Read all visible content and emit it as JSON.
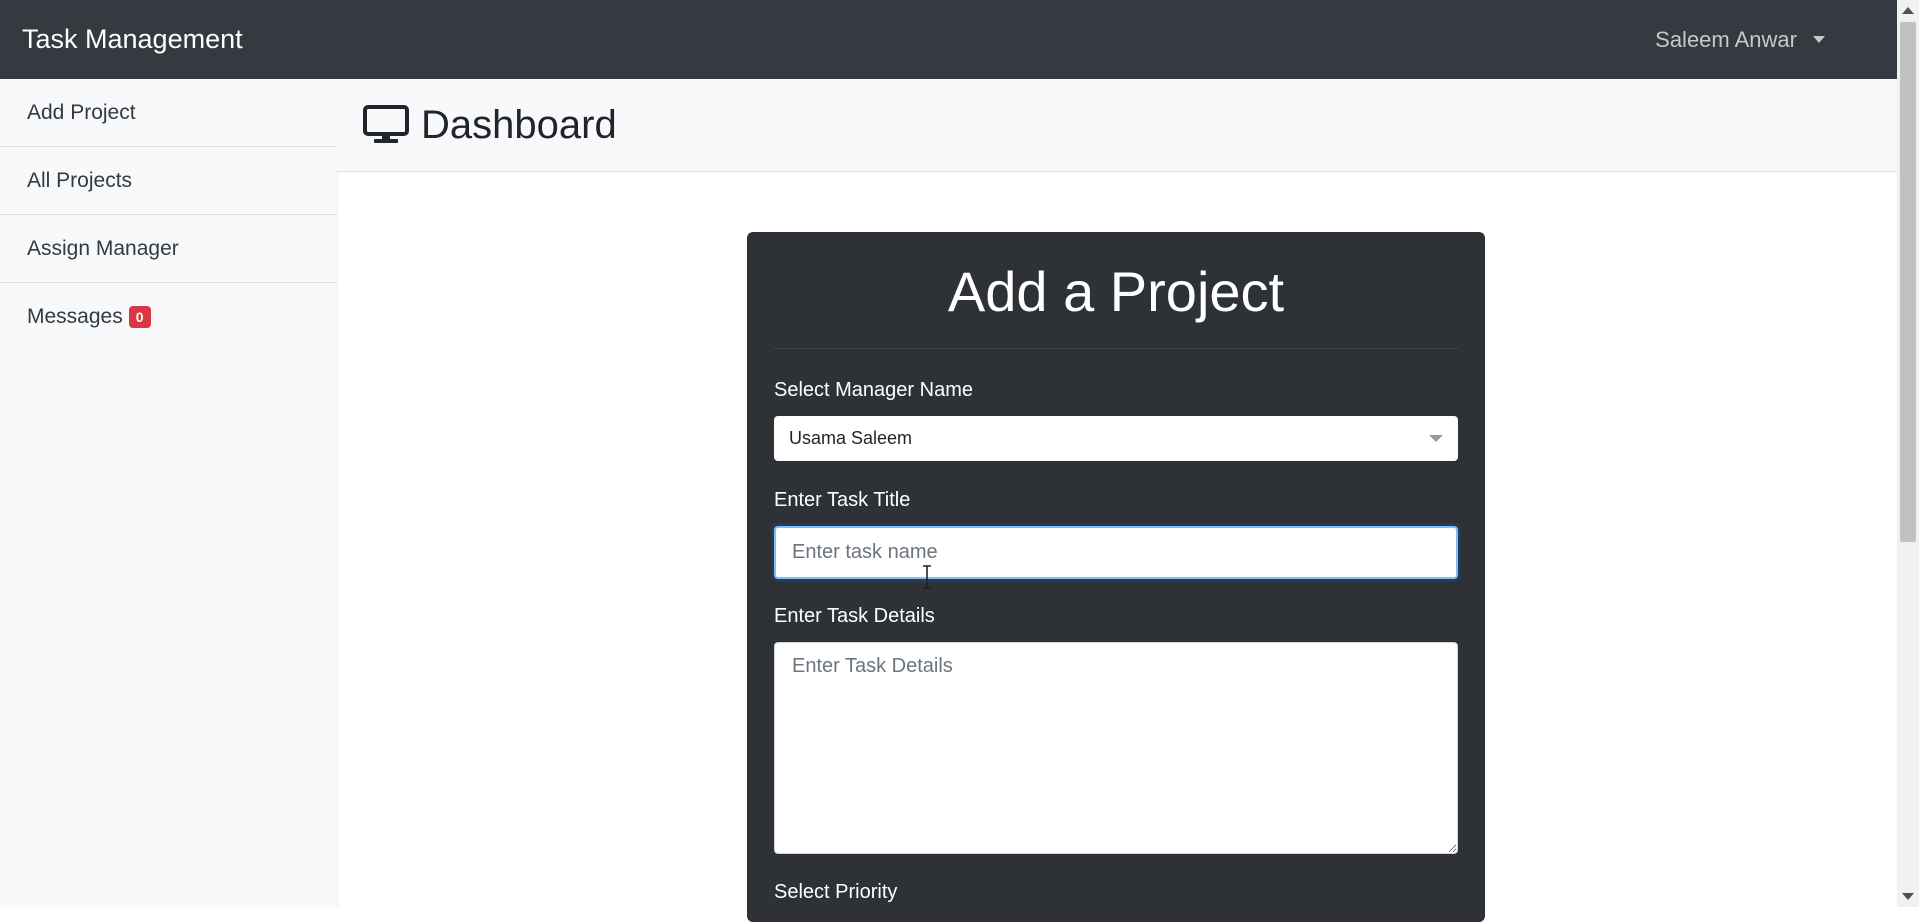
{
  "navbar": {
    "brand": "Task Management",
    "user_name": "Saleem Anwar"
  },
  "sidebar": {
    "items": [
      {
        "label": "Add Project"
      },
      {
        "label": "All Projects"
      },
      {
        "label": "Assign Manager"
      },
      {
        "label": "Messages",
        "badge": "0"
      }
    ]
  },
  "header": {
    "icon": "monitor-icon",
    "title": "Dashboard"
  },
  "form": {
    "title": "Add a Project",
    "manager_label": "Select Manager Name",
    "manager_selected": "Usama Saleem",
    "task_title_label": "Enter Task Title",
    "task_title_placeholder": "Enter task name",
    "task_details_label": "Enter Task Details",
    "task_details_placeholder": "Enter Task Details",
    "priority_label": "Select Priority"
  },
  "colors": {
    "navbar_bg": "#343a40",
    "card_bg": "#2e3236",
    "badge_bg": "#dc3545",
    "sidebar_bg": "#f8f9fa"
  }
}
